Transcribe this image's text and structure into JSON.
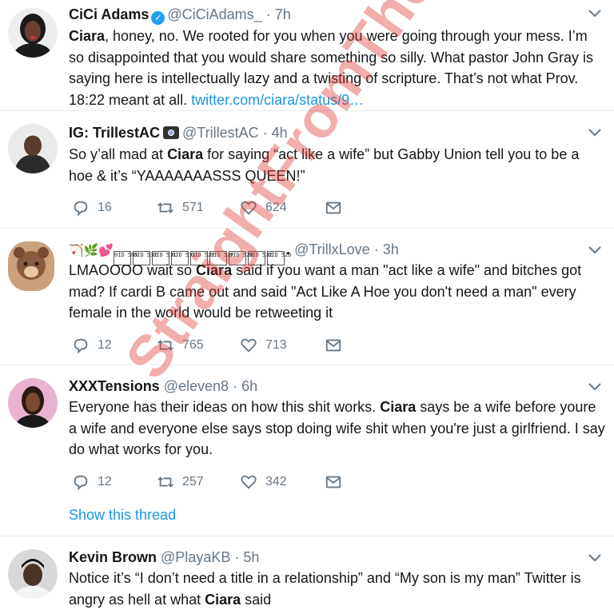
{
  "tweets": [
    {
      "name": "CiCi Adams",
      "handle": "@CiCiAdams_",
      "time": "7h",
      "text_pre": "",
      "highlight": "Ciara",
      "text_post": ", honey, no. We rooted for you when you were going through your mess. I’m so disappointed that you would share something so silly. What pastor John Gray is saying here is intellectually lazy and a twisting of scripture. That’s not what Prov. 18:22 meant at all. ",
      "link": "twitter.com/ciara/status/9…"
    },
    {
      "name": "IG: TrillestAC",
      "handle": "@TrillestAC",
      "time": "4h",
      "text_pre": "So y’all mad at ",
      "highlight": "Ciara",
      "text_post": " for saying “act like a wife” but Gabby Union tell you to be a hoe & it’s “YAAAAAAASSS QUEEN!”",
      "replies": "16",
      "retweets": "571",
      "likes": "624"
    },
    {
      "name_prefix": "🏹🌿💕",
      "name_boxes": [
        "0ID 505",
        "0ID 532",
        "0ID 531",
        "0ID 531",
        "0ID 522",
        "0ID 52F",
        "0ID 520",
        "0ID 532",
        "0ID 52D"
      ],
      "name_suffix": ".",
      "handle": "@TrillxLove",
      "time": "3h",
      "text_pre": "LMAOOOO wait so ",
      "highlight": "Ciara",
      "text_post": " said if you want a man \"act like a wife\" and bitches got mad? If cardi B came out and said \"Act Like A Hoe you don't need a man\" every female in the world would be retweeting it",
      "replies": "12",
      "retweets": "765",
      "likes": "713"
    },
    {
      "name": "XXXTensions",
      "handle": "@eleven8",
      "time": "6h",
      "text_pre": "Everyone has their ideas on how this shit works. ",
      "highlight": "Ciara",
      "text_post": " says be a wife before youre a wife and everyone else says stop doing wife shit when you're just a girlfriend. I say do what works for you.",
      "replies": "12",
      "retweets": "257",
      "likes": "342",
      "show_thread": "Show this thread"
    },
    {
      "name": "Kevin Brown",
      "handle": "@PlayaKB",
      "time": "5h",
      "text_pre": "Notice it’s “I don’t need a title in a relationship” and “My son is my man” Twitter is angry as hell at what ",
      "highlight": "Ciara",
      "text_post": " said"
    }
  ],
  "dot": "·",
  "watermark": "StraightFromTheA.com",
  "colors": {
    "link": "#1b95e0",
    "muted": "#657786",
    "verified": "#1da1f2",
    "watermark": "#e13c3c"
  }
}
